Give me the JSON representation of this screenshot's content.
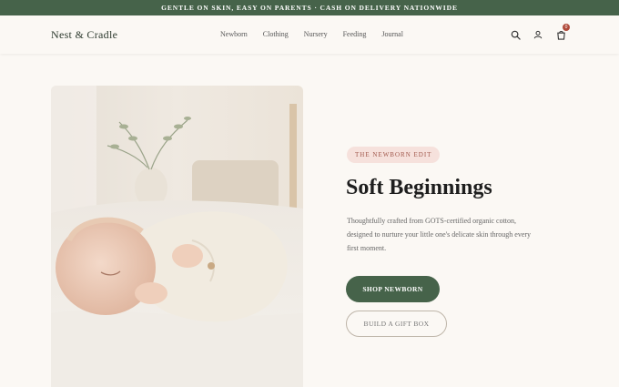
{
  "announcement": "GENTLE ON SKIN, EASY ON PARENTS · CASH ON DELIVERY NATIONWIDE",
  "brand": "Nest & Cradle",
  "nav": [
    "Newborn",
    "Clothing",
    "Nursery",
    "Feeding",
    "Journal"
  ],
  "cart_count": "0",
  "hero": {
    "tag": "THE NEWBORN EDIT",
    "title": "Soft Beginnings",
    "description": "Thoughtfully crafted from GOTS-certified organic cotton, designed to nurture your little one's delicate skin through every first moment.",
    "primary_cta": "SHOP NEWBORN",
    "secondary_cta": "BUILD A GIFT BOX"
  },
  "colors": {
    "brand_green": "#46634a",
    "tag_pink": "#f6e1dc",
    "background": "#fbf8f4"
  },
  "icons": [
    "search-icon",
    "account-icon",
    "cart-icon"
  ]
}
